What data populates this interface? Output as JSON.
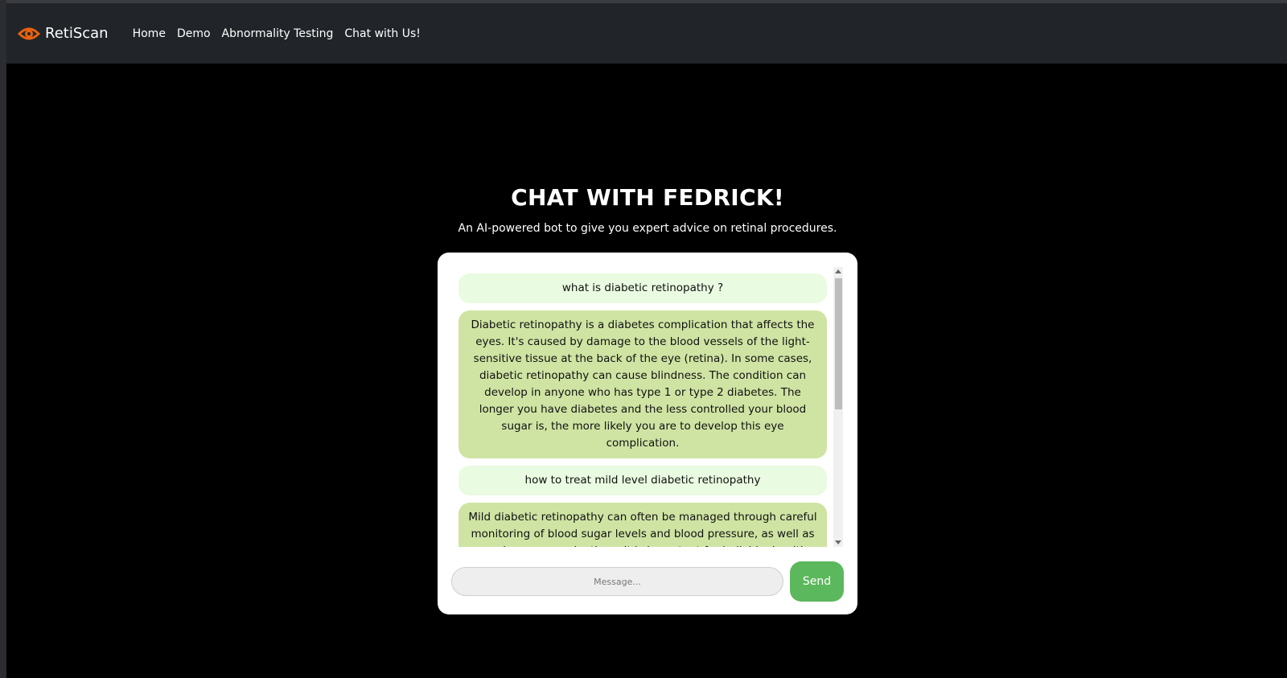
{
  "navbar": {
    "brand": "RetiScan",
    "brand_icon": "eye-icon",
    "brand_icon_color": "#e8620e",
    "links": [
      {
        "label": "Home"
      },
      {
        "label": "Demo"
      },
      {
        "label": "Abnormality Testing"
      },
      {
        "label": "Chat with Us!"
      }
    ]
  },
  "main": {
    "title": "CHAT WITH FEDRICK!",
    "subtitle": "An AI-powered bot to give you expert advice on retinal procedures."
  },
  "chat": {
    "messages": [
      {
        "role": "user",
        "text": "what is diabetic retinopathy ?"
      },
      {
        "role": "bot",
        "text": "Diabetic retinopathy is a diabetes complication that affects the eyes. It's caused by damage to the blood vessels of the light-sensitive tissue at the back of the eye (retina). In some cases, diabetic retinopathy can cause blindness. The condition can develop in anyone who has type 1 or type 2 diabetes. The longer you have diabetes and the less controlled your blood sugar is, the more likely you are to develop this eye complication."
      },
      {
        "role": "user",
        "text": "how to treat mild level diabetic retinopathy"
      },
      {
        "role": "bot",
        "text": "Mild diabetic retinopathy can often be managed through careful monitoring of blood sugar levels and blood pressure, as well as regular eye examinations. It is important for individuals with mild"
      }
    ],
    "input_placeholder": "Message...",
    "input_value": "",
    "send_label": "Send"
  },
  "colors": {
    "navbar_bg": "#212529",
    "user_bubble": "#e9fbe0",
    "bot_bubble": "#cfe4a3",
    "send_button": "#5cb85c"
  }
}
